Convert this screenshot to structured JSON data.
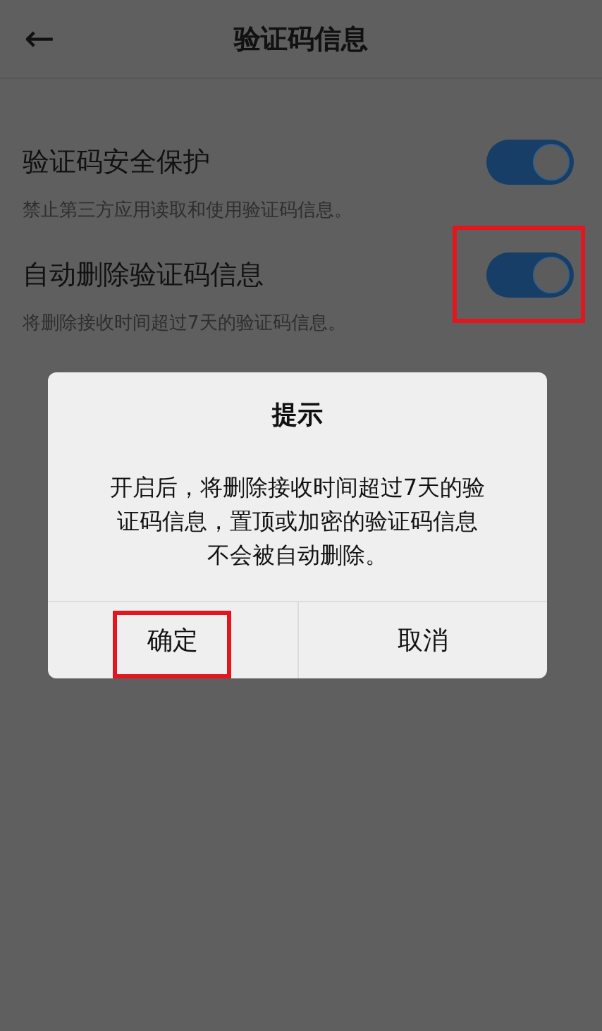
{
  "header": {
    "back": "←",
    "title": "验证码信息"
  },
  "settings": [
    {
      "label": "验证码安全保护",
      "description": "禁止第三方应用读取和使用验证码信息。",
      "on": true,
      "highlighted": false
    },
    {
      "label": "自动删除验证码信息",
      "description": "将删除接收时间超过7天的验证码信息。",
      "on": true,
      "highlighted": true
    }
  ],
  "dialog": {
    "title": "提示",
    "message": "开启后，将删除接收时间超过7天的验证码信息，置顶或加密的验证码信息不会被自动删除。",
    "buttons": [
      {
        "label": "确定",
        "highlighted": true
      },
      {
        "label": "取消",
        "highlighted": false
      }
    ]
  }
}
